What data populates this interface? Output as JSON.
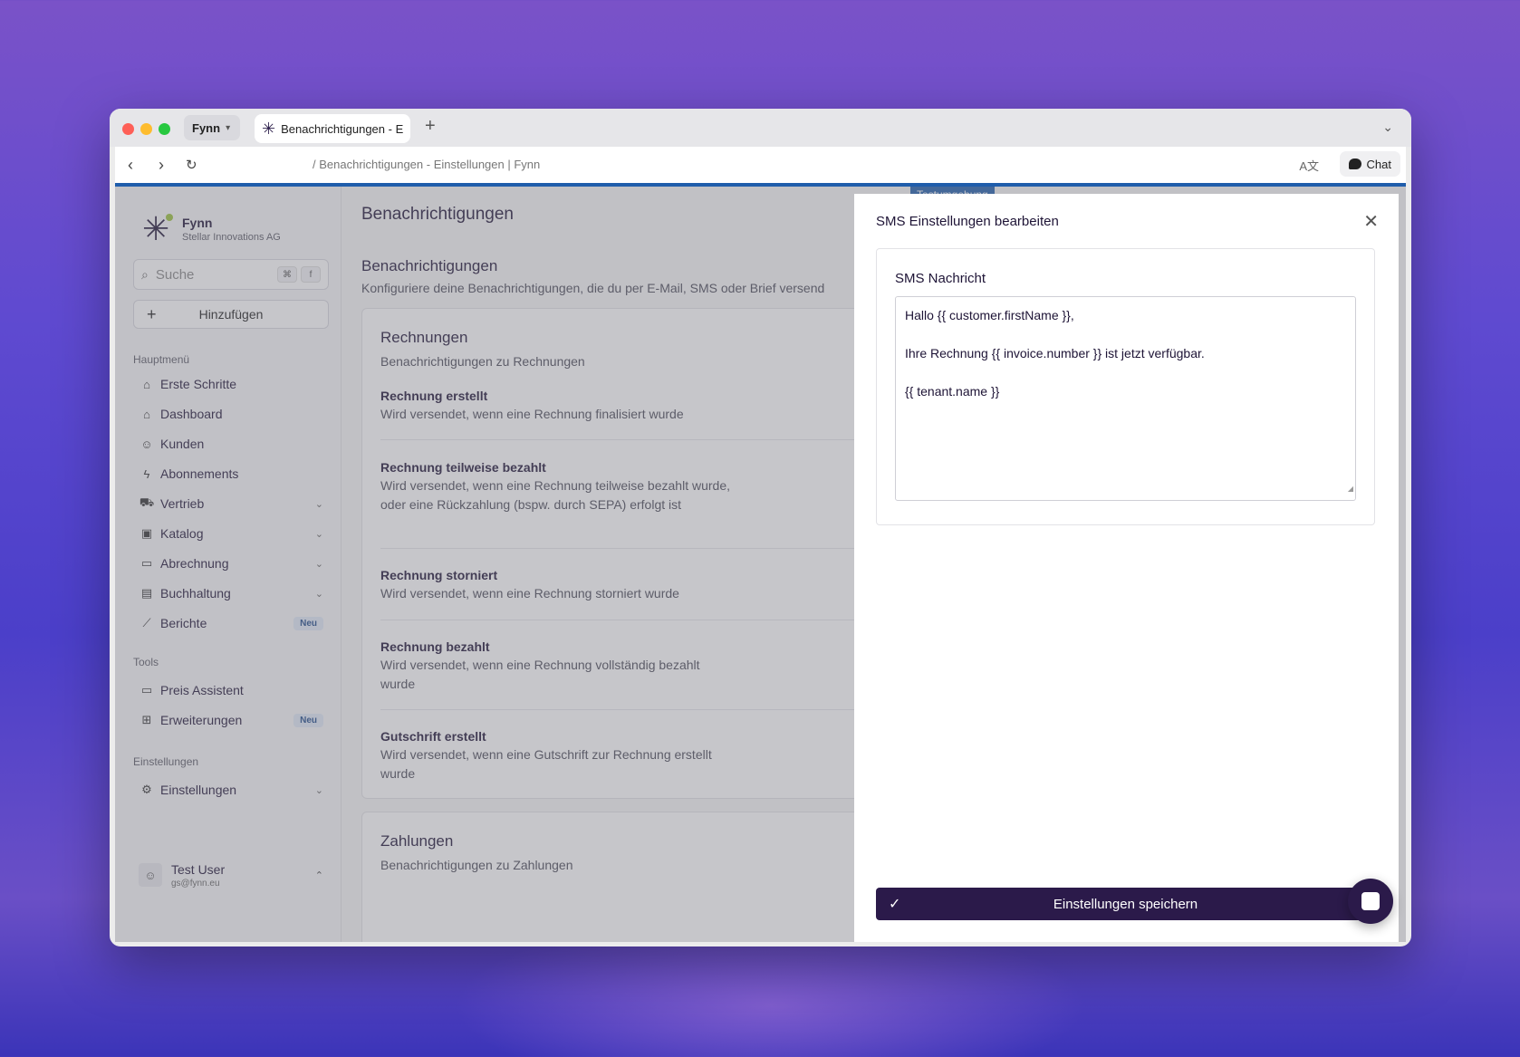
{
  "browser": {
    "profile": "Fynn",
    "tab_title": "Benachrichtigungen - E",
    "url": "/ Benachrichtigungen - Einstellungen | Fynn",
    "chat_label": "Chat"
  },
  "env_badge": "Testumgebung",
  "sidebar": {
    "org_name": "Fynn",
    "org_sub": "Stellar Innovations AG",
    "search_placeholder": "Suche",
    "kbd": [
      "⌘",
      "f"
    ],
    "add_label": "Hinzufügen",
    "sections": {
      "main": "Hauptmenü",
      "tools": "Tools",
      "settings": "Einstellungen"
    },
    "main_items": [
      {
        "label": "Erste Schritte",
        "icon": "home-icon"
      },
      {
        "label": "Dashboard",
        "icon": "house-outline-icon"
      },
      {
        "label": "Kunden",
        "icon": "user-icon"
      },
      {
        "label": "Abonnements",
        "icon": "bolt-icon"
      },
      {
        "label": "Vertrieb",
        "icon": "cart-icon"
      },
      {
        "label": "Katalog",
        "icon": "box-icon"
      },
      {
        "label": "Abrechnung",
        "icon": "card-icon"
      },
      {
        "label": "Buchhaltung",
        "icon": "calculator-icon"
      },
      {
        "label": "Berichte",
        "icon": "chart-icon",
        "badge": "Neu"
      }
    ],
    "tool_items": [
      {
        "label": "Preis Assistent",
        "icon": "money-icon"
      },
      {
        "label": "Erweiterungen",
        "icon": "grid-icon",
        "badge": "Neu"
      }
    ],
    "settings_item": {
      "label": "Einstellungen",
      "icon": "gear-icon"
    },
    "user": {
      "name": "Test User",
      "email": "gs@fynn.eu"
    }
  },
  "main": {
    "page_title": "Benachrichtigungen",
    "section_title": "Benachrichtigungen",
    "section_sub": "Konfiguriere deine Benachrichtigungen, die du per E-Mail, SMS oder Brief versend",
    "card1": {
      "title": "Rechnungen",
      "sub": "Benachrichtigungen zu Rechnungen",
      "rows": [
        {
          "title": "Rechnung erstellt",
          "desc": "Wird versendet, wenn eine Rechnung finalisiert wurde"
        },
        {
          "title": "Rechnung teilweise bezahlt",
          "desc": "Wird versendet, wenn eine Rechnung teilweise bezahlt wurde, oder eine Rückzahlung (bspw. durch SEPA) erfolgt ist"
        },
        {
          "title": "Rechnung storniert",
          "desc": "Wird versendet, wenn eine Rechnung storniert wurde"
        },
        {
          "title": "Rechnung bezahlt",
          "desc": "Wird versendet, wenn eine Rechnung vollständig bezahlt wurde"
        },
        {
          "title": "Gutschrift erstellt",
          "desc": "Wird versendet, wenn eine Gutschrift zur Rechnung erstellt wurde"
        }
      ]
    },
    "card2": {
      "title": "Zahlungen",
      "sub": "Benachrichtigungen zu Zahlungen"
    }
  },
  "drawer": {
    "title": "SMS Einstellungen bearbeiten",
    "field_label": "SMS Nachricht",
    "message_lines": [
      "Hallo {{ customer.firstName }},",
      "Ihre Rechnung {{ invoice.number }} ist jetzt verfügbar.",
      "{{ tenant.name }}"
    ],
    "save_label": "Einstellungen speichern"
  }
}
